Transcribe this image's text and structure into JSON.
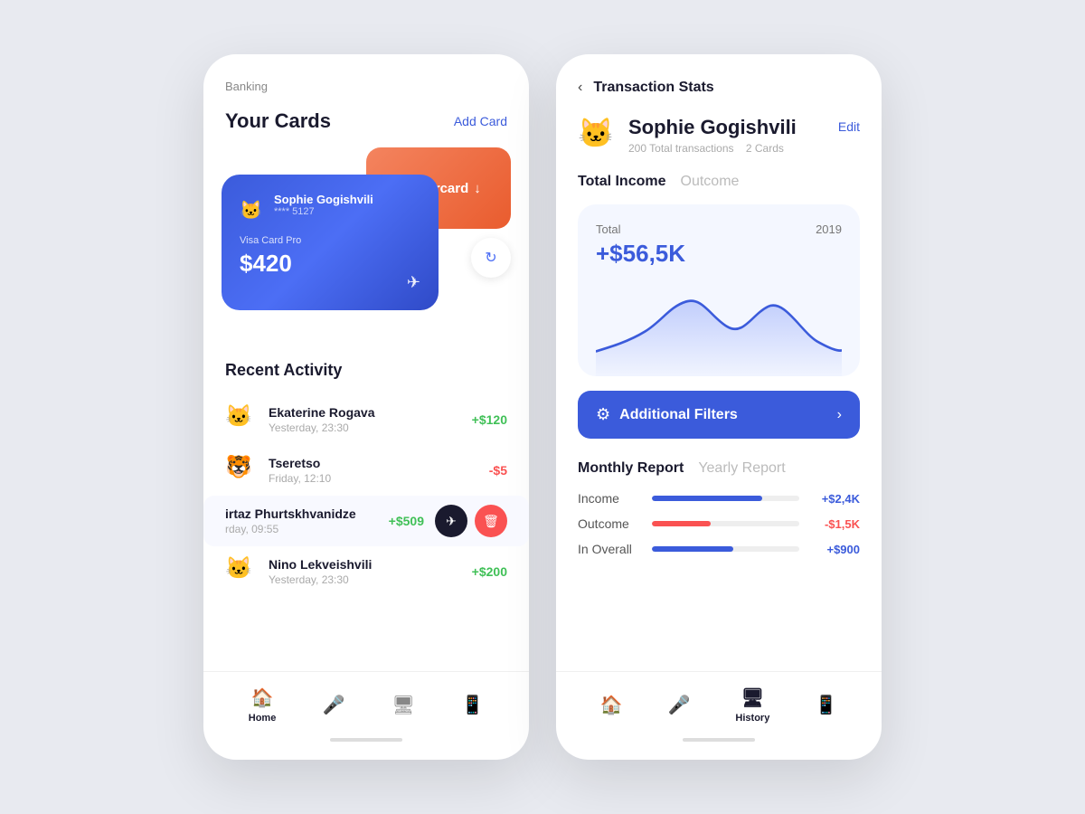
{
  "left": {
    "header": "Banking",
    "section_title": "Your Cards",
    "add_card": "Add Card",
    "mastercard": {
      "label": "Mastercard",
      "arrow": "↓"
    },
    "visa_card": {
      "card_label": "Visa Card Pro",
      "balance": "$420",
      "owner_name": "Sophie Gogishvili",
      "card_number": "**** 5127",
      "avatar": "🐱"
    },
    "recent_title": "Recent Activity",
    "activities": [
      {
        "name": "Ekaterine Rogava",
        "date": "Yesterday, 23:30",
        "amount": "+$120",
        "type": "positive",
        "avatar": "🐱"
      },
      {
        "name": "Tseretso",
        "date": "Friday, 12:10",
        "amount": "-$5",
        "type": "negative",
        "avatar": "🐯"
      },
      {
        "name": "irtaz Phurtskhvanidze",
        "date": "rday, 09:55",
        "amount": "+$509",
        "type": "positive",
        "avatar": "",
        "highlighted": true
      },
      {
        "name": "Nino Lekveishvili",
        "date": "Yesterday, 23:30",
        "amount": "+$200",
        "type": "positive",
        "avatar": "🐱"
      }
    ],
    "nav_items": [
      {
        "label": "Home",
        "icon": "🏠",
        "active": true
      },
      {
        "label": "",
        "icon": "🎤",
        "active": false
      },
      {
        "label": "",
        "icon": "🖥",
        "active": false
      },
      {
        "label": "",
        "icon": "📱",
        "active": false
      }
    ]
  },
  "right": {
    "back_label": "‹",
    "title": "Transaction Stats",
    "user_name": "Sophie Gogishvili",
    "user_avatar": "🐱",
    "user_total_transactions": "200 Total transactions",
    "user_cards": "2 Cards",
    "edit_label": "Edit",
    "income_tabs": [
      {
        "label": "Total Income",
        "active": true
      },
      {
        "label": "Outcome",
        "active": false
      }
    ],
    "chart": {
      "label": "Total",
      "year": "2019",
      "value": "+$56,5K"
    },
    "filters_label": "Additional Filters",
    "report_tabs": [
      {
        "label": "Monthly Report",
        "active": true
      },
      {
        "label": "Yearly Report",
        "active": false
      }
    ],
    "report_rows": [
      {
        "label": "Income",
        "amount": "+$2,4K",
        "fill": 75,
        "type": "income"
      },
      {
        "label": "Outcome",
        "amount": "-$1,5K",
        "fill": 40,
        "type": "outcome"
      },
      {
        "label": "In Overall",
        "amount": "+$900",
        "fill": 55,
        "type": "overall"
      }
    ],
    "nav_items": [
      {
        "label": "",
        "icon": "🏠",
        "active": false
      },
      {
        "label": "",
        "icon": "🎤",
        "active": false
      },
      {
        "label": "History",
        "icon": "🖥",
        "active": true
      },
      {
        "label": "",
        "icon": "📱",
        "active": false
      }
    ]
  }
}
